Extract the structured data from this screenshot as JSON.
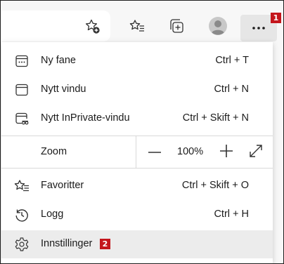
{
  "toolbar": {
    "icons": [
      "add-to-favorites-icon",
      "favorites-icon",
      "collections-icon",
      "profile-avatar-icon",
      "more-icon"
    ],
    "more_label": "...",
    "badge_1": "1"
  },
  "menu": {
    "new_tab": {
      "label": "Ny fane",
      "shortcut": "Ctrl + T"
    },
    "new_window": {
      "label": "Nytt vindu",
      "shortcut": "Ctrl + N"
    },
    "new_inprivate": {
      "label": "Nytt InPrivate-vindu",
      "shortcut": "Ctrl + Skift + N"
    },
    "zoom": {
      "label": "Zoom",
      "value": "100%",
      "minus": "—",
      "plus": "+"
    },
    "favorites": {
      "label": "Favoritter",
      "shortcut": "Ctrl + Skift + O"
    },
    "history": {
      "label": "Logg",
      "shortcut": "Ctrl + H"
    },
    "settings": {
      "label": "Innstillinger",
      "badge": "2"
    }
  },
  "colors": {
    "badge": "#c4161c",
    "highlight": "#ececec",
    "more_button_bg": "#e6e6e6"
  }
}
